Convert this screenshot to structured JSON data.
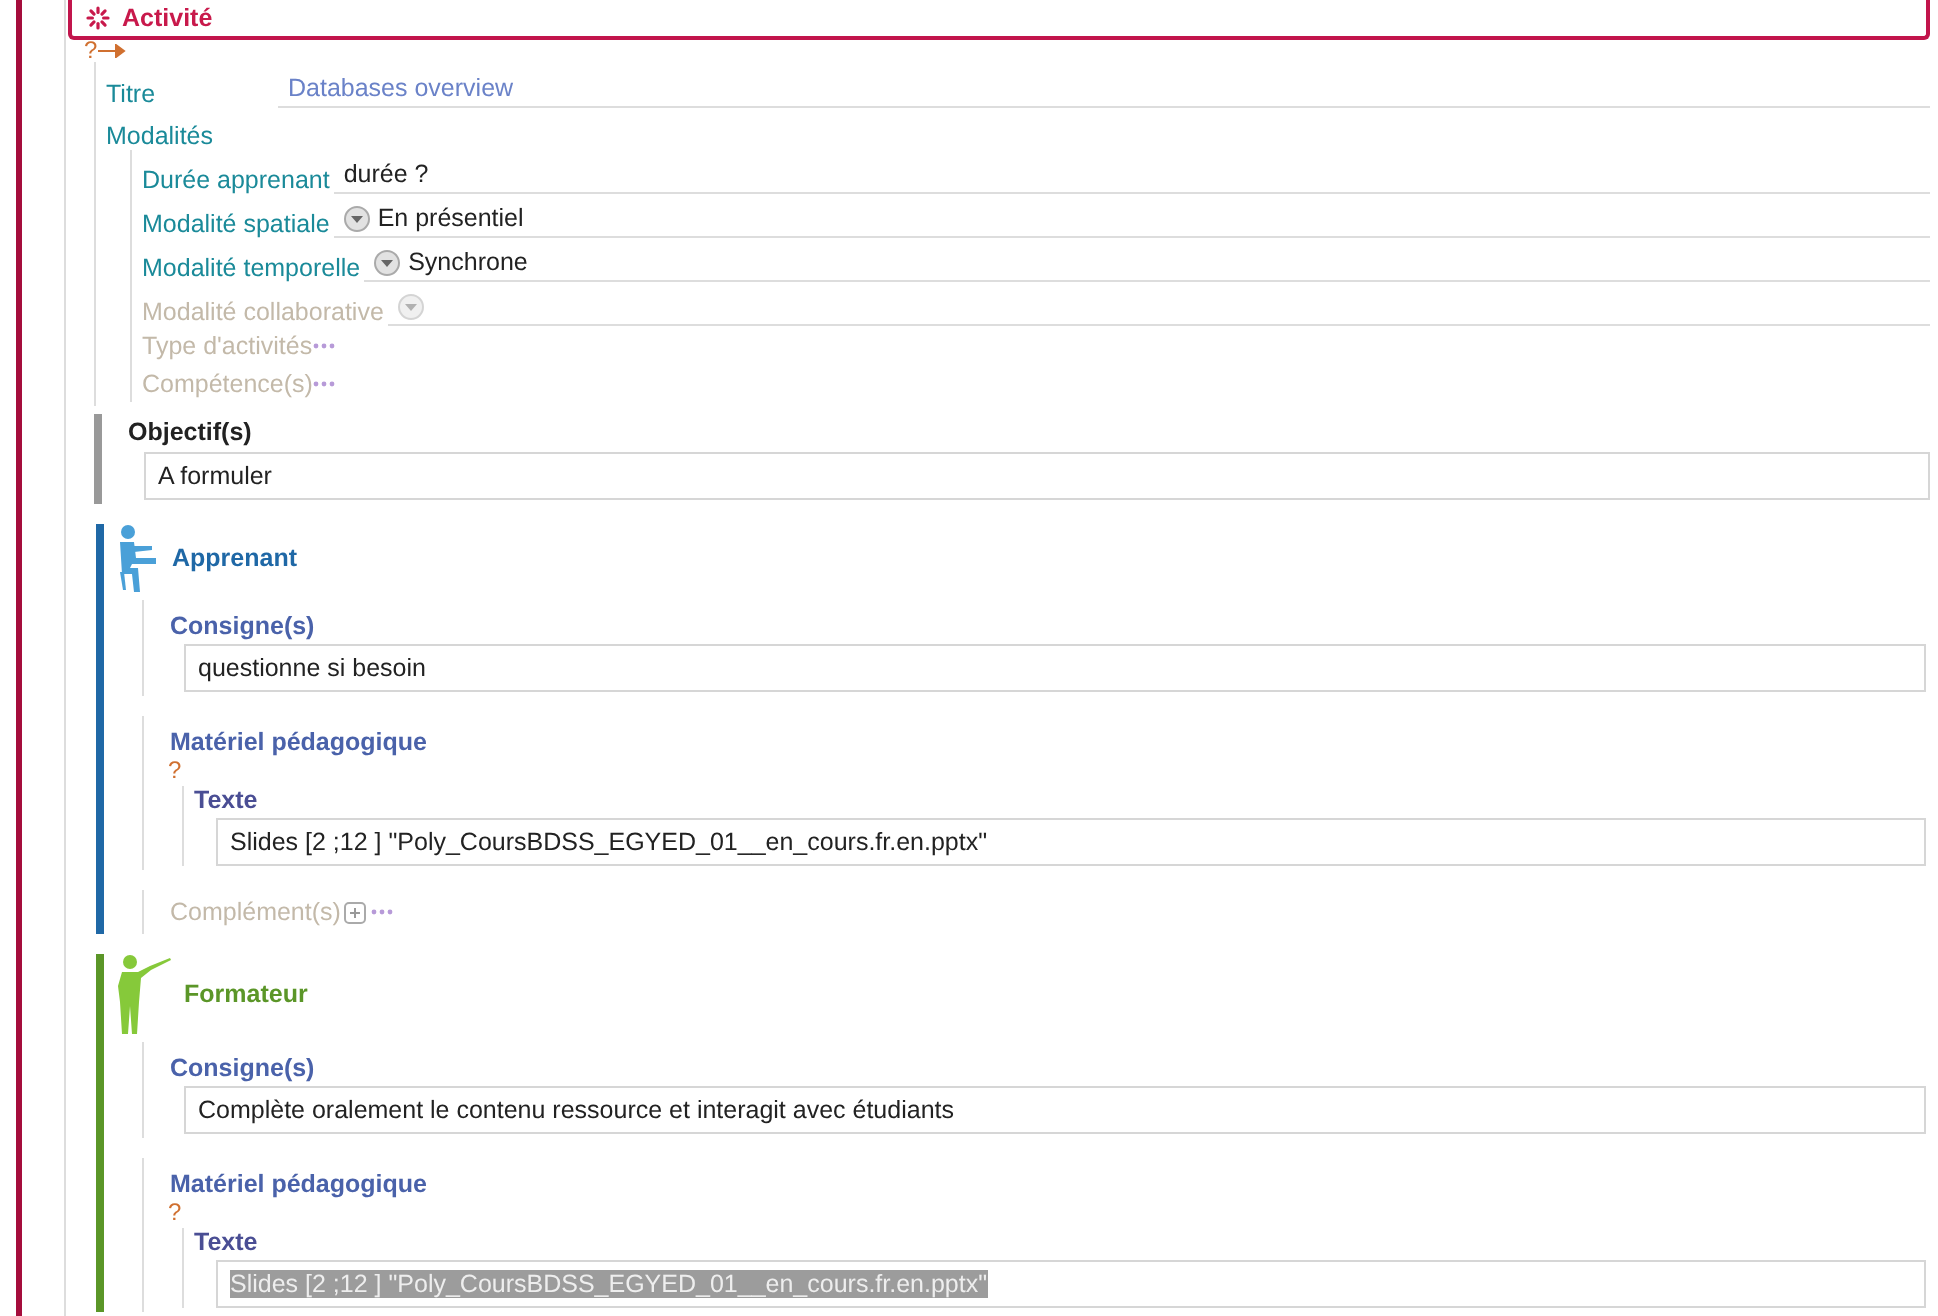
{
  "header": {
    "title": "Activité",
    "marker": "?"
  },
  "title_field": {
    "label": "Titre",
    "value": "Databases overview"
  },
  "modalities": {
    "label": "Modalités",
    "fields": [
      {
        "kind": "text",
        "label": "Durée apprenant",
        "value": "durée ?",
        "disabled": false
      },
      {
        "kind": "select",
        "label": "Modalité spatiale",
        "value": "En présentiel",
        "disabled": false
      },
      {
        "kind": "select",
        "label": "Modalité temporelle",
        "value": "Synchrone",
        "disabled": false
      },
      {
        "kind": "select",
        "label": "Modalité collaborative",
        "disabled": true
      },
      {
        "kind": "more",
        "label": "Type d'activités",
        "disabled": true
      },
      {
        "kind": "more",
        "label": "Compétence(s)",
        "disabled": true
      }
    ]
  },
  "objectives": {
    "label": "Objectif(s)",
    "value": "A formuler"
  },
  "roles": [
    {
      "kind": "learner",
      "title": "Apprenant",
      "color": "#1f68a6",
      "instructions_label": "Consigne(s)",
      "instructions": "questionne si besoin",
      "material_label": "Matériel pédagogique",
      "marker": "?",
      "text_label": "Texte",
      "text": "Slides [2 ;12 ] \"Poly_CoursBDSS_EGYED_01__en_cours.fr.en.pptx\"",
      "text_selected": false,
      "complement_label": "Complément(s)"
    },
    {
      "kind": "trainer",
      "title": "Formateur",
      "color": "#5b9628",
      "instructions_label": "Consigne(s)",
      "instructions": "Complète oralement le contenu ressource et interagit avec étudiants",
      "material_label": "Matériel pédagogique",
      "marker": "?",
      "text_label": "Texte",
      "text": "Slides [2 ;12 ] \"Poly_CoursBDSS_EGYED_01__en_cours.fr.en.pptx\"",
      "text_selected": true
    }
  ]
}
